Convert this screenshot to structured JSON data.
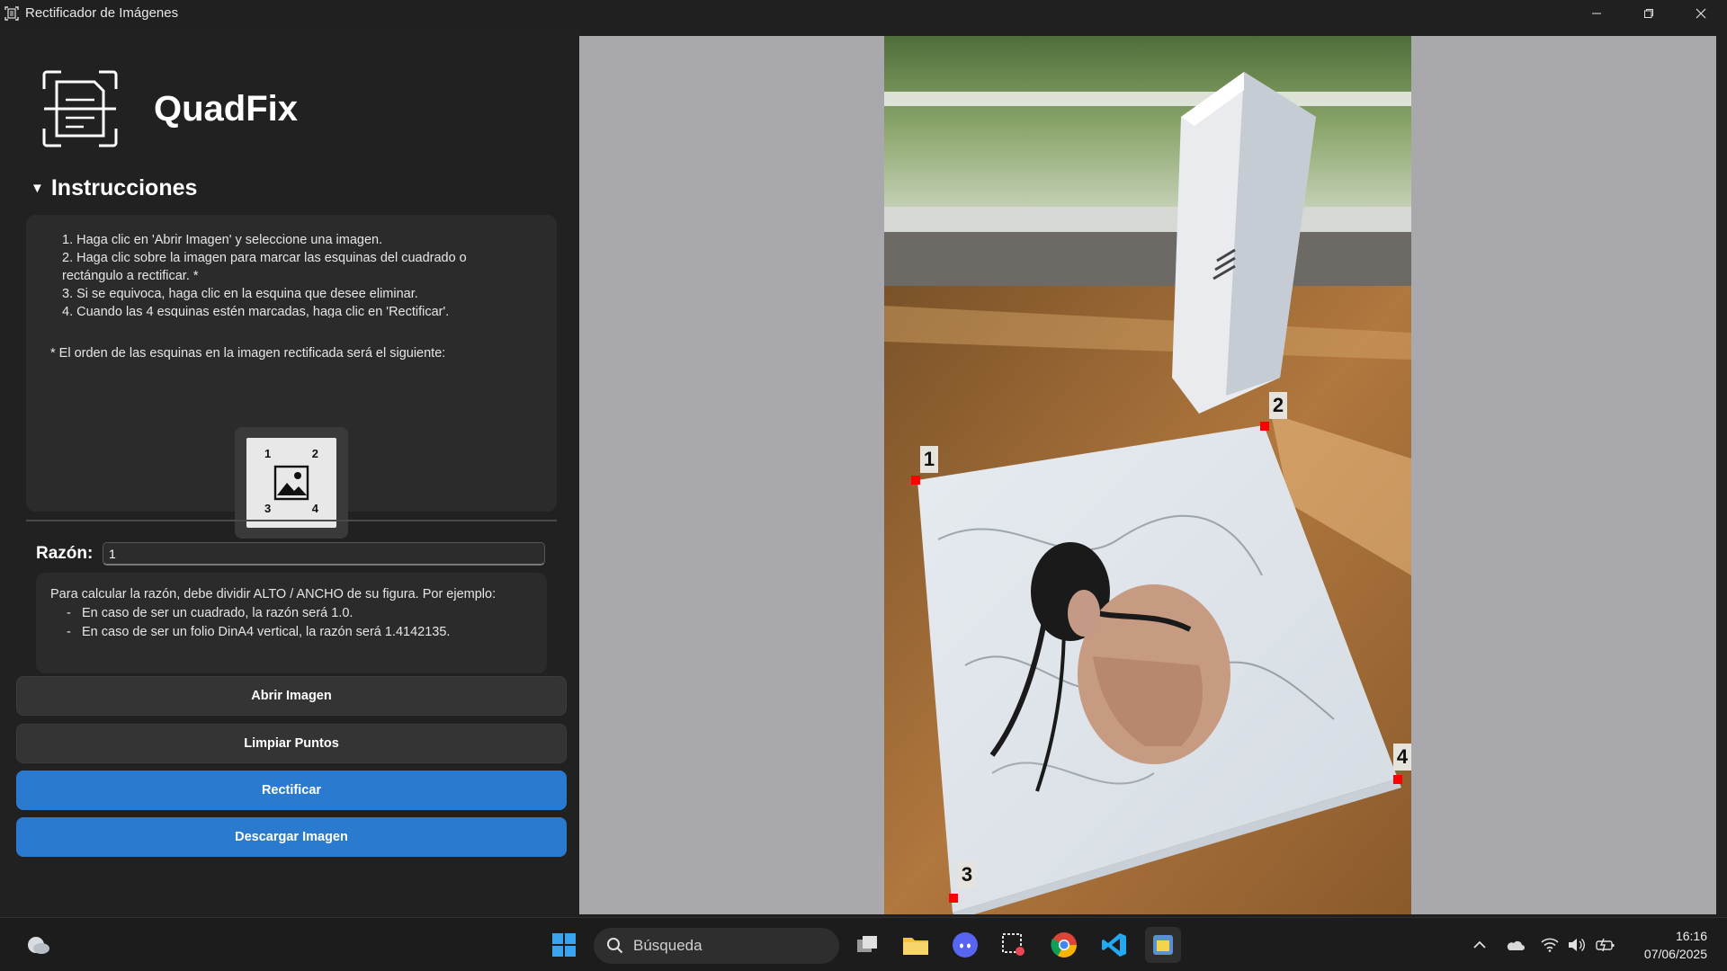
{
  "window": {
    "title": "Rectificador de Imágenes",
    "controls": [
      "minimize",
      "restore",
      "close"
    ]
  },
  "brand": {
    "name": "QuadFix",
    "logo_icon": "document-scan-icon"
  },
  "instructions": {
    "header": "Instrucciones",
    "expanded": true,
    "steps": [
      "1. Haga clic en 'Abrir Imagen' y seleccione una imagen.",
      "2. Haga clic sobre la imagen para marcar las esquinas del cuadrado o rectángulo a rectificar. *",
      "3. Si se equivoca, haga clic en la esquina que desee eliminar.",
      "4. Cuando las 4 esquinas estén marcadas, haga clic en 'Rectificar'."
    ],
    "note": "* El orden de las esquinas en la imagen rectificada será el siguiente:",
    "order_labels": [
      "1",
      "2",
      "3",
      "4"
    ]
  },
  "ratio": {
    "label": "Razón:",
    "value": "1",
    "help_intro": "Para calcular la razón, debe dividir ALTO / ANCHO de su figura. Por ejemplo:",
    "help_items": [
      "En caso de ser un cuadrado, la razón será 1.0.",
      "En caso de ser un folio DinA4 vertical, la razón será 1.4142135."
    ]
  },
  "buttons": {
    "open": "Abrir Imagen",
    "clear": "Limpiar Puntos",
    "rectify": "Rectificar",
    "download": "Descargar Imagen"
  },
  "image_points": [
    "1",
    "2",
    "3",
    "4"
  ],
  "taskbar": {
    "search_placeholder": "Búsqueda",
    "time": "16:16",
    "date": "07/06/2025",
    "apps": [
      "weather-icon",
      "windows-start-icon",
      "task-view-icon",
      "file-explorer-icon",
      "discord-icon",
      "snipping-tool-icon",
      "chrome-icon",
      "vscode-icon",
      "python-app-icon"
    ]
  },
  "colors": {
    "accent_blue": "#2a7bd0",
    "point_red": "#ff0000",
    "panel_bg": "#212121",
    "viewer_bg": "#a9a9ad"
  }
}
